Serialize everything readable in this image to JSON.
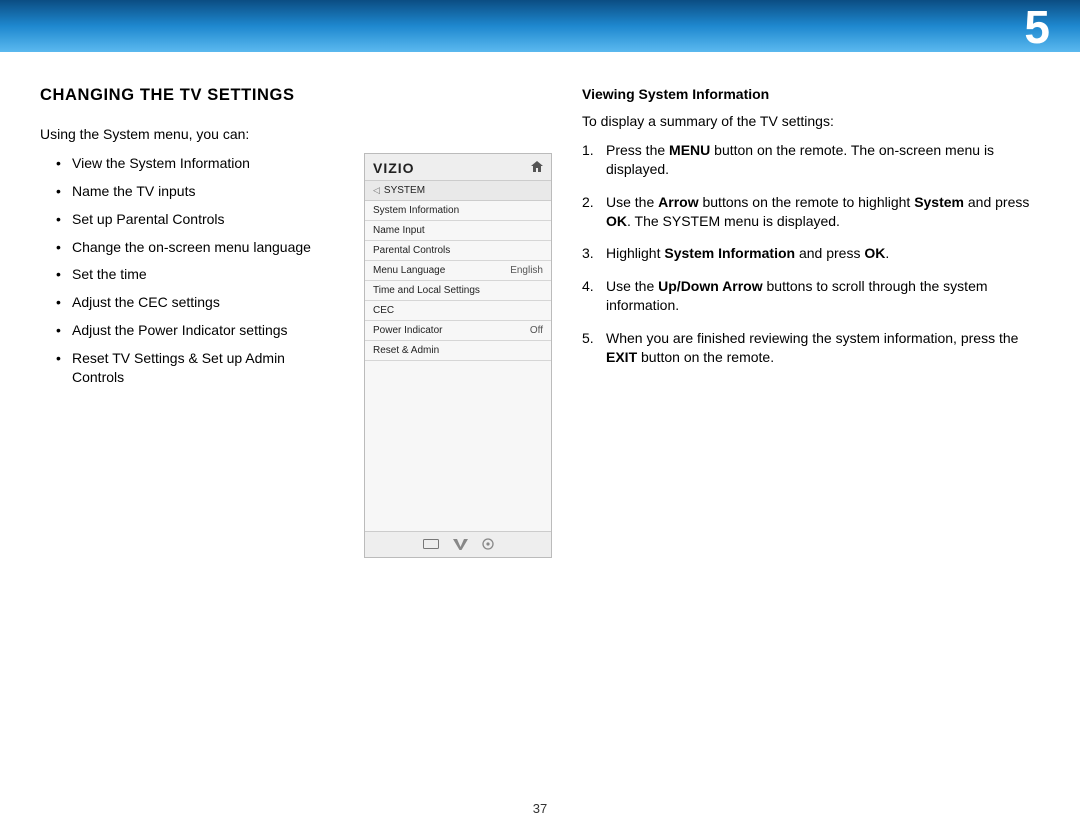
{
  "chapter": "5",
  "page_number": "37",
  "left": {
    "title": "CHANGING THE TV SETTINGS",
    "intro": "Using the System menu, you can:",
    "bullets": [
      "View the System Information",
      "Name the TV inputs",
      "Set up Parental Controls",
      "Change the on-screen menu language",
      "Set the time",
      "Adjust the CEC settings",
      "Adjust the Power Indicator settings",
      "Reset TV Settings & Set up Admin Controls"
    ]
  },
  "tv_menu": {
    "brand": "VIZIO",
    "crumb": "SYSTEM",
    "rows": [
      {
        "label": "System Information",
        "value": ""
      },
      {
        "label": "Name Input",
        "value": ""
      },
      {
        "label": "Parental Controls",
        "value": ""
      },
      {
        "label": "Menu Language",
        "value": "English"
      },
      {
        "label": "Time and Local Settings",
        "value": ""
      },
      {
        "label": "CEC",
        "value": ""
      },
      {
        "label": "Power Indicator",
        "value": "Off"
      },
      {
        "label": "Reset & Admin",
        "value": ""
      }
    ]
  },
  "right": {
    "title": "Viewing System Information",
    "intro": "To display a summary of the TV settings:",
    "steps_parts": {
      "s1": {
        "a": "Press the ",
        "b": "MENU",
        "c": " button on the remote. The on-screen menu is displayed."
      },
      "s2": {
        "a": "Use the ",
        "b": "Arrow",
        "c": " buttons on the remote to highlight ",
        "d": "System",
        "e": " and press ",
        "f": "OK",
        "g": ". The SYSTEM menu is displayed."
      },
      "s3": {
        "a": "Highlight ",
        "b": "System Information",
        "c": " and press ",
        "d": "OK",
        "e": "."
      },
      "s4": {
        "a": "Use the ",
        "b": "Up/Down Arrow",
        "c": " buttons to scroll through the system information."
      },
      "s5": {
        "a": "When you are finished reviewing the system information, press the ",
        "b": "EXIT",
        "c": " button on the remote."
      }
    }
  }
}
